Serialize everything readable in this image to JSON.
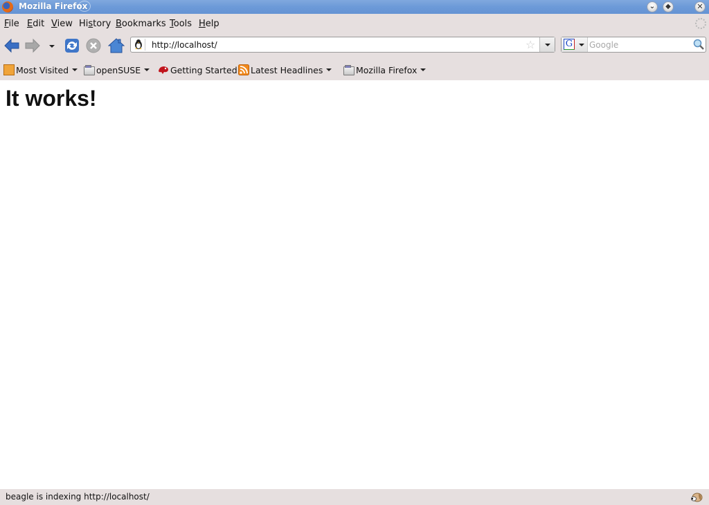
{
  "window": {
    "title": "Mozilla Firefox",
    "controls": {
      "minimize": "⌄",
      "maximize": "◆",
      "close": "✕"
    }
  },
  "menubar": {
    "items": [
      {
        "label": "File",
        "accel": "F"
      },
      {
        "label": "Edit",
        "accel": "E"
      },
      {
        "label": "View",
        "accel": "V"
      },
      {
        "label": "History",
        "accel": "s"
      },
      {
        "label": "Bookmarks",
        "accel": "B"
      },
      {
        "label": "Tools",
        "accel": "T"
      },
      {
        "label": "Help",
        "accel": "H"
      }
    ]
  },
  "navbar": {
    "url": "http://localhost/",
    "site_icon": "tux-penguin-icon",
    "search": {
      "engine": "G",
      "placeholder": "Google",
      "value": ""
    }
  },
  "bookmarks": {
    "items": [
      {
        "label": "Most Visited",
        "icon": "most-visited-icon",
        "dropdown": true
      },
      {
        "label": "openSUSE",
        "icon": "folder-icon",
        "dropdown": true
      },
      {
        "label": "Getting Started",
        "icon": "opensuse-chameleon-icon",
        "dropdown": false
      },
      {
        "label": "Latest Headlines",
        "icon": "rss-feed-icon",
        "dropdown": true
      },
      {
        "label": "Mozilla Firefox",
        "icon": "folder-icon",
        "dropdown": true
      }
    ]
  },
  "content": {
    "heading": "It works!"
  },
  "statusbar": {
    "text": "beagle is indexing http://localhost/",
    "icon": "beagle-dog-icon"
  },
  "colors": {
    "titlebar": "#6c9ad8",
    "chrome": "#e6dfdf",
    "accent_blue": "#3a6fc4"
  }
}
